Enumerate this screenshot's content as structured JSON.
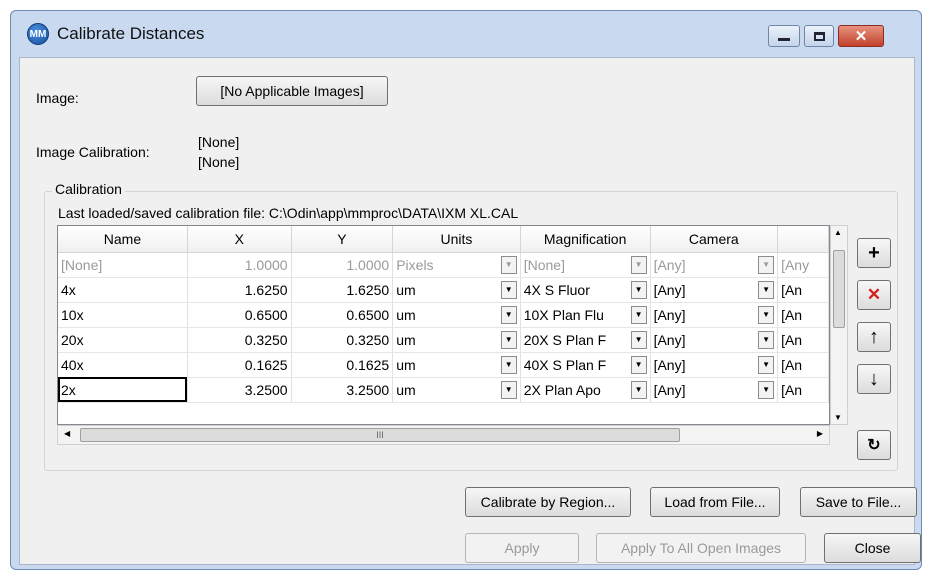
{
  "window": {
    "title": "Calibrate Distances",
    "icon": "mm-logo-icon",
    "controls": {
      "minimize": "–",
      "maximize": "□",
      "close": "✕"
    }
  },
  "image": {
    "label": "Image:",
    "button": "[No Applicable Images]"
  },
  "image_calibration": {
    "label": "Image Calibration:",
    "value1": "[None]",
    "value2": "[None]"
  },
  "calibration": {
    "caption": "Calibration",
    "last_file_text": "Last loaded/saved calibration file: C:\\Odin\\app\\mmproc\\DATA\\IXM XL.CAL",
    "columns": [
      "Name",
      "X",
      "Y",
      "Units",
      "Magnification",
      "Camera",
      ""
    ],
    "rows": [
      {
        "name": "[None]",
        "x": "1.0000",
        "y": "1.0000",
        "units": "Pixels",
        "mag": "[None]",
        "camera": "[Any]",
        "extra": "[Any"
      },
      {
        "name": "4x",
        "x": "1.6250",
        "y": "1.6250",
        "units": "um",
        "mag": "4X S Fluor",
        "camera": "[Any]",
        "extra": "[An"
      },
      {
        "name": "10x",
        "x": "0.6500",
        "y": "0.6500",
        "units": "um",
        "mag": "10X Plan Flu",
        "camera": "[Any]",
        "extra": "[An"
      },
      {
        "name": "20x",
        "x": "0.3250",
        "y": "0.3250",
        "units": "um",
        "mag": "20X S Plan F",
        "camera": "[Any]",
        "extra": "[An"
      },
      {
        "name": "40x",
        "x": "0.1625",
        "y": "0.1625",
        "units": "um",
        "mag": "40X S Plan F",
        "camera": "[Any]",
        "extra": "[An"
      },
      {
        "name": "2x",
        "x": "3.2500",
        "y": "3.2500",
        "units": "um",
        "mag": "2X Plan Apo",
        "camera": "[Any]",
        "extra": "[An"
      }
    ],
    "scroll_grip": "III"
  },
  "side_buttons": {
    "add": "+",
    "delete": "✕",
    "up": "↑",
    "down": "↓",
    "clear": "↻"
  },
  "buttons": {
    "calibrate_by_region": "Calibrate by Region...",
    "load_from_file": "Load from File...",
    "save_to_file": "Save to File...",
    "apply": "Apply",
    "apply_all": "Apply To All Open Images",
    "close": "Close"
  },
  "colors": {
    "title_bar": "#c9daf0",
    "close_button": "#c2412c",
    "delete_icon": "#d32020"
  }
}
